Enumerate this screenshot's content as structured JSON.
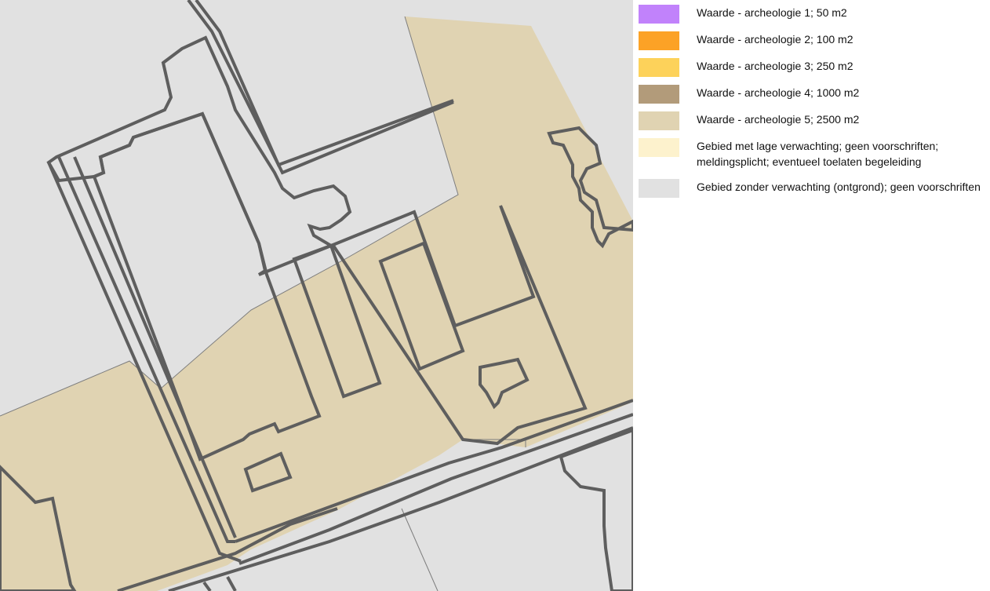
{
  "map": {
    "colors": {
      "background": "#e1e1e1",
      "zone_fill": "#e0d3b2",
      "outline": "#5e5e5e",
      "thin_line": "#7d7d7d"
    }
  },
  "legend": {
    "items": [
      {
        "lines": [
          "Waarde - archeologie 1; 50 m2"
        ],
        "color": "#c182fb"
      },
      {
        "lines": [
          "Waarde - archeologie 2; 100 m2"
        ],
        "color": "#fca226"
      },
      {
        "lines": [
          "Waarde - archeologie 3; 250 m2"
        ],
        "color": "#fdd25a"
      },
      {
        "lines": [
          "Waarde - archeologie 4; 1000 m2"
        ],
        "color": "#b29b7a"
      },
      {
        "lines": [
          "Waarde - archeologie 5; 2500 m2"
        ],
        "color": "#e0d3b2"
      },
      {
        "lines": [
          "Gebied met lage verwachting; geen voorschriften;",
          "meldingsplicht; eventueel toelaten begeleiding"
        ],
        "color": "#fdf2cd"
      },
      {
        "lines": [
          "Gebied zonder verwachting (ontgrond); geen voorschriften"
        ],
        "color": "#e1e1e1"
      }
    ]
  }
}
